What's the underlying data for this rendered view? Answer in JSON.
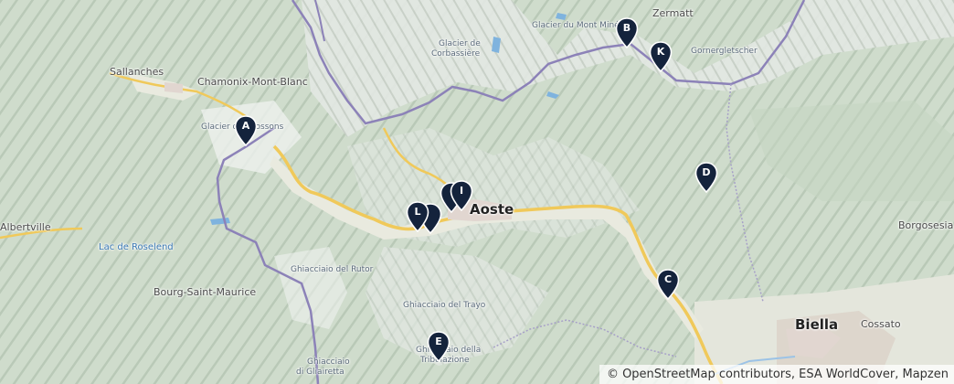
{
  "labels": {
    "zermatt": "Zermatt",
    "glacier_mont_mine": "Glacier du Mont Miné",
    "gornergletscher": "Gornergletscher",
    "glacier_corbassiere_1": "Glacier de",
    "glacier_corbassiere_2": "Corbassière",
    "sallanches": "Sallanches",
    "chamonix": "Chamonix-Mont-Blanc",
    "glacier_bossons": "Glacier des Bossons",
    "albertville": "Albertville",
    "lac_roselend": "Lac de Roselend",
    "bourg_saint_maurice": "Bourg-Saint-Maurice",
    "ghiacciaio_rutor": "Ghiacciaio del Rutor",
    "ghiacciaio_trayo": "Ghiacciaio del Trayo",
    "ghiacciaio_tribolazione_1": "Ghiacciaio della",
    "ghiacciaio_tribolazione_2": "Tribolazione",
    "ghiacciaio_gliairetta_1": "Ghiacciaio",
    "ghiacciaio_gliairetta_2": "di Gliairetta",
    "aoste": "Aoste",
    "borgosesia": "Borgosesia",
    "biella": "Biella",
    "cossato": "Cossato"
  },
  "markers": [
    "A",
    "B",
    "C",
    "D",
    "E",
    "I",
    "K",
    "L"
  ],
  "marker_color": "#14233c",
  "attribution": "© OpenStreetMap contributors, ESA WorldCover, Mapzen"
}
